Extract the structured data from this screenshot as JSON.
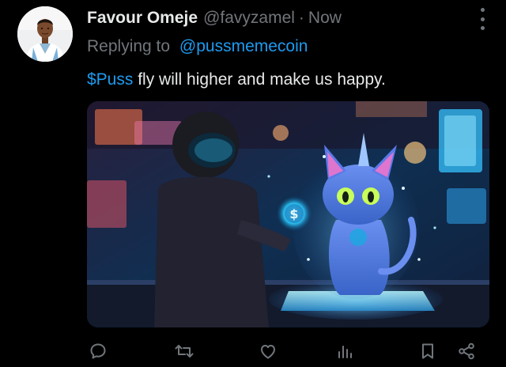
{
  "tweet": {
    "author": {
      "display_name": "Favour Omeje",
      "handle": "@favyzamel",
      "separator": "·",
      "time": "Now",
      "avatar_icon": "avatar-photo"
    },
    "reply": {
      "label": "Replying to",
      "mention": "@pussmemecoin"
    },
    "text": {
      "cashtag": "$Puss",
      "body": " fly will higher and make us happy."
    },
    "media": {
      "description_icon": "ai-art-hacker-and-glowing-cat-image"
    },
    "actions": [
      {
        "icon": "reply-icon"
      },
      {
        "icon": "retweet-icon"
      },
      {
        "icon": "like-icon"
      },
      {
        "icon": "views-icon"
      },
      {
        "icon": "bookmark-icon"
      },
      {
        "icon": "share-icon"
      }
    ]
  },
  "colors": {
    "background": "#000000",
    "primary_text": "#e7e9ea",
    "secondary_text": "#71767b",
    "accent": "#1d9bf0"
  }
}
